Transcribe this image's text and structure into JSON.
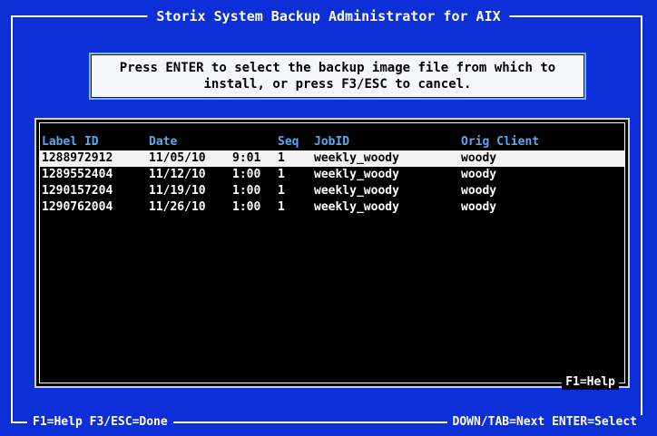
{
  "window": {
    "title": "Storix System Backup Administrator for AIX"
  },
  "prompt": {
    "line1": "Press ENTER to select the backup image file from which to",
    "line2": "install, or press F3/ESC to cancel."
  },
  "list": {
    "headers": {
      "label_id": "Label ID",
      "date": "Date",
      "seq": "Seq",
      "job_id": "JobID",
      "orig_client": "Orig Client"
    },
    "rows": [
      {
        "label_id": "1288972912",
        "date": "11/05/10",
        "time": "9:01",
        "seq": "1",
        "job_id": "weekly_woody",
        "orig_client": "woody"
      },
      {
        "label_id": "1289552404",
        "date": "11/12/10",
        "time": "1:00",
        "seq": "1",
        "job_id": "weekly_woody",
        "orig_client": "woody"
      },
      {
        "label_id": "1290157204",
        "date": "11/19/10",
        "time": "1:00",
        "seq": "1",
        "job_id": "weekly_woody",
        "orig_client": "woody"
      },
      {
        "label_id": "1290762004",
        "date": "11/26/10",
        "time": "1:00",
        "seq": "1",
        "job_id": "weekly_woody",
        "orig_client": "woody"
      }
    ],
    "selected_index": 0,
    "help_hint": "F1=Help"
  },
  "status_bar": {
    "left": "F1=Help  F3/ESC=Done",
    "right": "DOWN/TAB=Next  ENTER=Select"
  },
  "colors": {
    "background": "#0c2fd8",
    "header_text": "#5ea8f0",
    "selection": "#f2f2f2"
  }
}
